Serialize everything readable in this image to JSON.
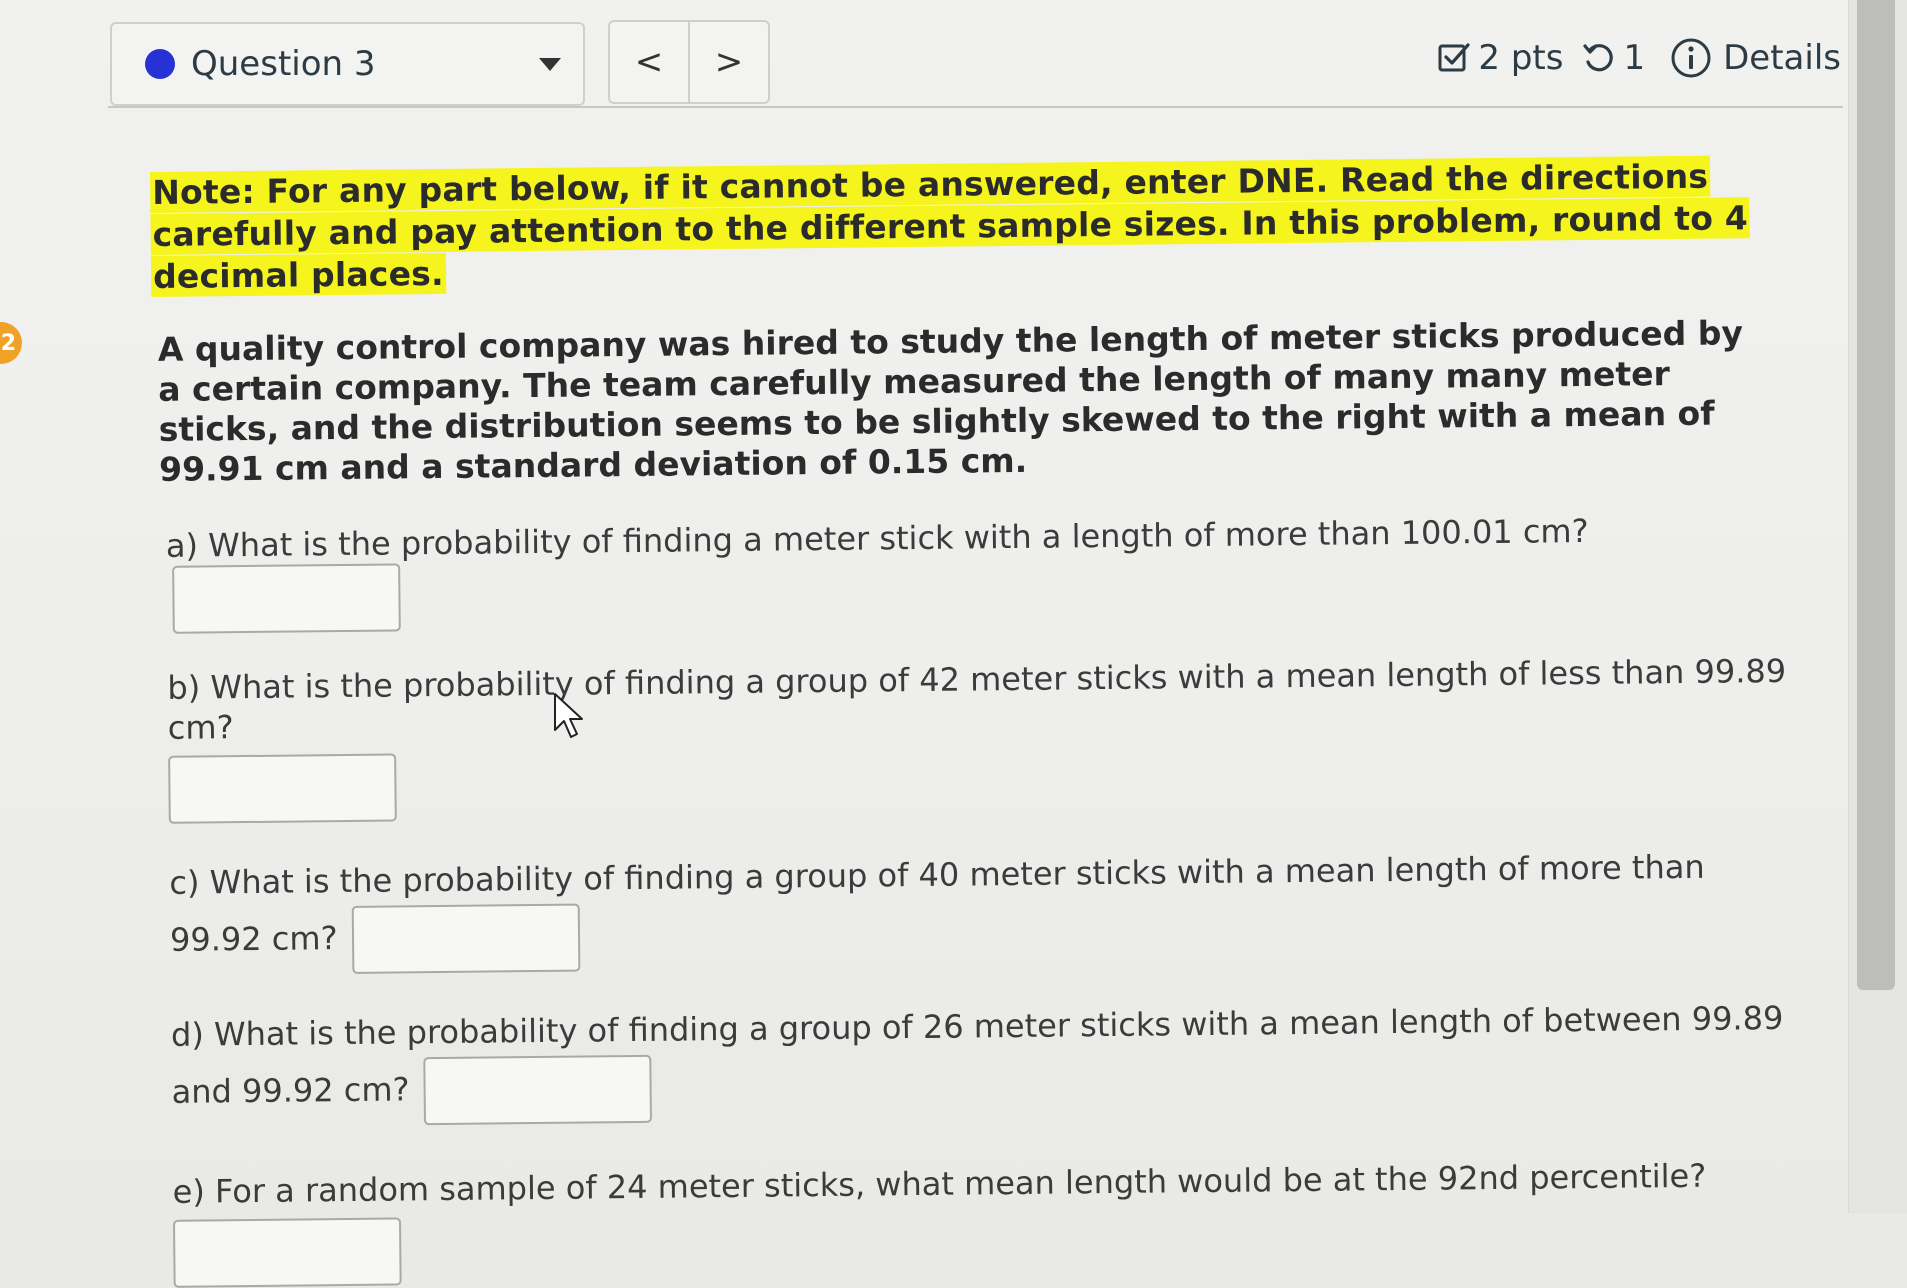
{
  "header": {
    "question_label": "Question 3",
    "prev_label": "<",
    "next_label": ">",
    "points_label": "2 pts",
    "attempts_label": "1",
    "details_label": "Details"
  },
  "badge": {
    "text": "2"
  },
  "note": "Note: For any part below, if it cannot be answered, enter DNE. Read the directions carefully and pay attention to the different sample sizes. In this problem, round to 4 decimal places.",
  "intro": "A quality control company was hired to study the length of meter sticks produced by a certain company. The team carefully measured the length of many many meter sticks, and the distribution seems to be slightly skewed to the right with a mean of 99.91 cm and a standard deviation of 0.15 cm.",
  "parts": {
    "a": {
      "text": "a) What is the probability of finding a meter stick with a length of more than 100.01 cm?",
      "value": ""
    },
    "b": {
      "text": "b) What is the probability of finding a group of 42 meter sticks with a mean length of less than 99.89 cm?",
      "value": ""
    },
    "c": {
      "text": "c) What is the probability of finding a group of 40 meter sticks with a mean length of more than 99.92 cm?",
      "value": ""
    },
    "d": {
      "text": "d) What is the probability of finding a group of 26 meter sticks with a mean length of between 99.89 and 99.92 cm?",
      "value": ""
    },
    "e": {
      "text": "e) For a random sample of 24 meter sticks, what mean length would be at the 92nd percentile?",
      "value": ""
    }
  },
  "colors": {
    "highlight": "#f5f51d",
    "question_dot": "#2631d6",
    "badge": "#f0a127"
  }
}
